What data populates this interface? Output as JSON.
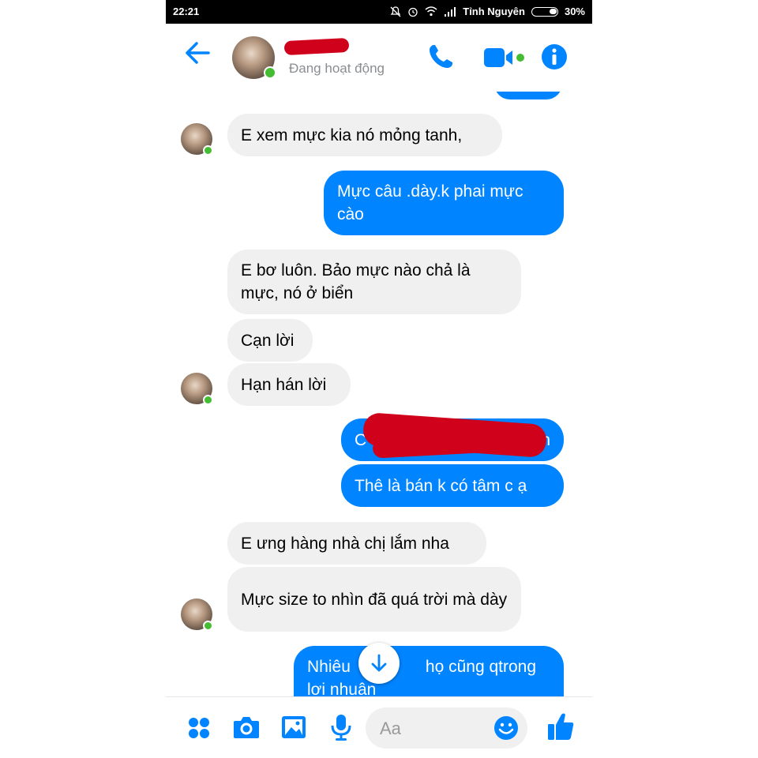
{
  "statusbar": {
    "time": "22:21",
    "carrier": "Tỉnh Nguyên",
    "battery": "30%",
    "icons": [
      "mute-icon",
      "alarm-icon",
      "wifi-icon",
      "signal-icon",
      "battery-icon"
    ]
  },
  "header": {
    "status": "Đang hoạt động",
    "icons": [
      "back-arrow-icon",
      "phone-icon",
      "video-icon",
      "info-icon"
    ]
  },
  "colors": {
    "accent": "#0084ff",
    "incoming_bubble": "#f1f0f0",
    "online": "#44bd32",
    "redaction": "#d0021b"
  },
  "messages": [
    {
      "from": "them",
      "text": "E xem mực kia nó mỏng tanh,"
    },
    {
      "from": "me",
      "text": "Mực câu .dày.k phai mực cào"
    },
    {
      "from": "them",
      "text": "E bơ luôn. Bảo mực nào chả là mực, nó ở biển"
    },
    {
      "from": "them",
      "text": "Cạn lời"
    },
    {
      "from": "them",
      "text": "Hạn hán lời"
    },
    {
      "from": "me",
      "text": "C",
      "text_end": "iển",
      "redacted": true
    },
    {
      "from": "me",
      "text": "Thê là bán k có tâm c ạ"
    },
    {
      "from": "them",
      "text": "E ưng hàng nhà chị lắm nha"
    },
    {
      "from": "them",
      "text": "Mực size to nhìn đã quá trời mà dày"
    },
    {
      "from": "me",
      "text_start": "Nhiêu",
      "text_end": "họ cũng qtrong",
      "text_line2": "lơi nhuân"
    }
  ],
  "composer": {
    "placeholder": "Aa",
    "icons": [
      "apps-icon",
      "camera-icon",
      "gallery-icon",
      "microphone-icon",
      "emoji-icon",
      "thumbs-up-icon"
    ]
  },
  "scroll_button": "arrow-down-icon"
}
